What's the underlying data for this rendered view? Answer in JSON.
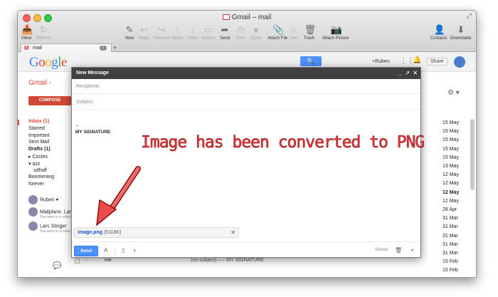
{
  "window": {
    "title": "Gmail – mail"
  },
  "toolbar": {
    "left": [
      {
        "label": "Inbox",
        "icon": "inbox-icon",
        "dim": false
      },
      {
        "label": "Refresh",
        "icon": "refresh-icon",
        "dim": true
      }
    ],
    "main": [
      {
        "label": "New",
        "icon": "new-icon",
        "dim": false
      },
      {
        "label": "Reply",
        "icon": "reply-icon",
        "dim": true
      },
      {
        "label": "Forward",
        "icon": "forward-icon",
        "dim": true
      },
      {
        "label": "Newer",
        "icon": "newer-icon",
        "dim": true
      },
      {
        "label": "Older",
        "icon": "older-icon",
        "dim": true
      },
      {
        "label": "Archive",
        "icon": "archive-icon",
        "dim": true
      },
      {
        "label": "Send",
        "icon": "send-icon",
        "dim": false
      },
      {
        "label": "Print",
        "icon": "print-icon",
        "dim": true
      },
      {
        "label": "Spam",
        "icon": "spam-icon",
        "dim": true
      },
      {
        "label": "Attach File",
        "icon": "attach-file-icon",
        "dim": false
      },
      {
        "label": "Star",
        "icon": "star-icon",
        "dim": true
      },
      {
        "label": "Trash",
        "icon": "trash-icon",
        "dim": false
      },
      {
        "label": "Attach Picture",
        "icon": "camera-icon",
        "dim": false
      }
    ],
    "right": [
      {
        "label": "Contacts",
        "icon": "contacts-icon",
        "dim": false
      },
      {
        "label": "Downloads",
        "icon": "downloads-icon",
        "dim": false
      }
    ]
  },
  "tabs": {
    "mail_tab": "mail",
    "count": "1",
    "add": "+"
  },
  "gmail": {
    "logo": "Google",
    "label": "Gmail -",
    "compose": "COMPOSE",
    "user": "+Ruben",
    "share": "Share",
    "nav": [
      {
        "label": "Inbox (1)",
        "active": true
      },
      {
        "label": "Starred"
      },
      {
        "label": "Important"
      },
      {
        "label": "Sent Mail"
      },
      {
        "label": "Drafts (1)",
        "bold": true
      },
      {
        "label": "▸ Circles"
      },
      {
        "label": "▾ azz"
      },
      {
        "label": "sdfsdf",
        "indent": true
      },
      {
        "label": "Boomerang"
      },
      {
        "label": "forever"
      }
    ],
    "hangouts": [
      {
        "name": "Ruben ▾",
        "sub": ""
      },
      {
        "name": "Mailplane, Lars",
        "sub": "You were in a video call"
      },
      {
        "name": "Lars Steiger",
        "sub": "You were in a video call"
      }
    ],
    "dates": [
      {
        "text": "15 May",
        "bold": false
      },
      {
        "text": "15 May",
        "bold": false
      },
      {
        "text": "15 May",
        "bold": false
      },
      {
        "text": "15 May",
        "bold": false
      },
      {
        "text": "15 May",
        "bold": false
      },
      {
        "text": "13 May",
        "bold": false
      },
      {
        "text": "12 May",
        "bold": false
      },
      {
        "text": "12 May",
        "bold": false
      },
      {
        "text": "12 May",
        "bold": true
      },
      {
        "text": "12 May",
        "bold": false
      },
      {
        "text": "28 Apr",
        "bold": false
      },
      {
        "text": "31 Mar",
        "bold": false
      },
      {
        "text": "31 Mar",
        "bold": false
      },
      {
        "text": "31 Mar",
        "bold": false
      },
      {
        "text": "31 Mar",
        "bold": false
      },
      {
        "text": "31 Mar",
        "bold": false
      },
      {
        "text": "15 Feb",
        "bold": false
      },
      {
        "text": "15 Feb",
        "bold": false
      },
      {
        "text": "14 Feb",
        "bold": false
      },
      {
        "text": "13 Feb",
        "bold": false
      }
    ],
    "bottom_row": {
      "sender": "me",
      "subject": "(no subject) – – MY SIGNATURE"
    }
  },
  "compose_window": {
    "title": "New Message",
    "recipients_placeholder": "Recipients",
    "subject_placeholder": "Subject",
    "signature_dash": "--",
    "signature": "MY SIGNATURE",
    "attachment": {
      "name": "image.png",
      "size": "(5118K)"
    },
    "send": "Send",
    "saved": "Saved"
  },
  "annotation": {
    "text": "Image has been converted to PNG",
    "color": "#e8373c"
  }
}
